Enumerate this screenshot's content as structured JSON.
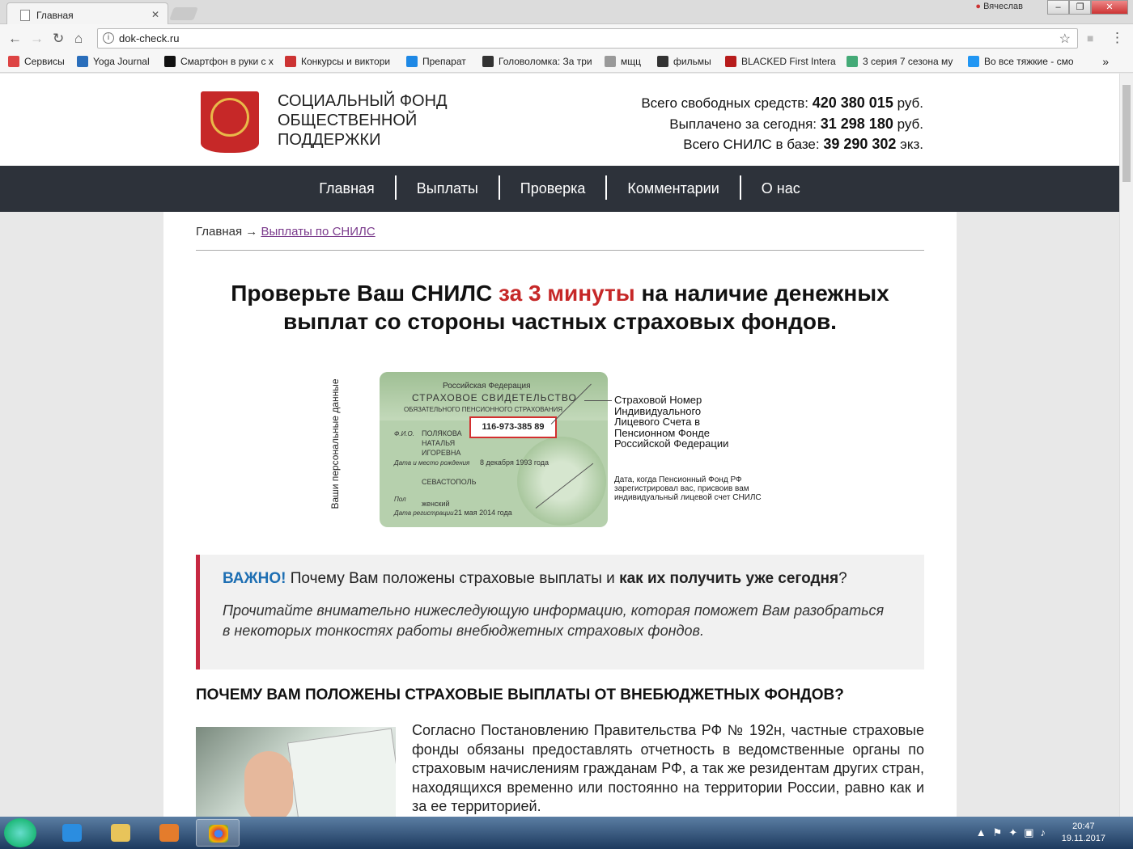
{
  "browser": {
    "tab_title": "Главная",
    "tab_close": "✕",
    "user": "Вячеслав",
    "url": "dok-check.ru",
    "bookmarks": [
      {
        "label": "Сервисы",
        "color": "#d44"
      },
      {
        "label": "Yoga Journal",
        "color": "#2a6ebb"
      },
      {
        "label": "Смартфон в руки с х",
        "color": "#111"
      },
      {
        "label": "Конкурсы и виктори",
        "color": "#c33"
      },
      {
        "label": "Препарат",
        "color": "#1e88e5"
      },
      {
        "label": "Головоломка: За три",
        "color": "#333"
      },
      {
        "label": "мщц",
        "color": "#999"
      },
      {
        "label": "фильмы",
        "color": "#333"
      },
      {
        "label": "BLACKED First Intera",
        "color": "#b71c1c"
      },
      {
        "label": "3 серия 7 сезона му",
        "color": "#4a7"
      },
      {
        "label": "Во все тяжкие - смо",
        "color": "#2196f3"
      }
    ]
  },
  "header": {
    "brand_line1": "СОЦИАЛЬНЫЙ ФОНД",
    "brand_line2": "ОБЩЕСТВЕННОЙ",
    "brand_line3": "ПОДДЕРЖКИ",
    "stat1_label": "Всего свободных средств:",
    "stat1_value": "420 380 015",
    "stat1_unit": "руб.",
    "stat2_label": "Выплачено за сегодня:",
    "stat2_value": "31 298 180",
    "stat2_unit": "руб.",
    "stat3_label": "Всего СНИЛС в базе:",
    "stat3_value": "39 290 302",
    "stat3_unit": "экз."
  },
  "menu": {
    "home": "Главная",
    "payments": "Выплаты",
    "check": "Проверка",
    "comments": "Комментарии",
    "about": "О нас"
  },
  "breadcrumb": {
    "home": "Главная",
    "arrow": "→",
    "current": "Выплаты по СНИЛС"
  },
  "headline": {
    "part1": "Проверьте Ваш СНИЛС ",
    "accent": "за 3 минуты",
    "part2": " на наличие денежных выплат со стороны частных страховых фондов."
  },
  "card": {
    "country": "Российская Федерация",
    "title": "СТРАХОВОЕ СВИДЕТЕЛЬСТВО",
    "subtitle": "ОБЯЗАТЕЛЬНОГО ПЕНСИОННОГО СТРАХОВАНИЯ",
    "number": "116-973-385 89",
    "fio_label": "Ф.И.О.",
    "fio1": "ПОЛЯКОВА",
    "fio2": "НАТАЛЬЯ",
    "fio3": "ИГОРЕВНА",
    "birth_label": "Дата и место рождения",
    "birth_date": "8 декабря 1993 года",
    "city": "СЕВАСТОПОЛЬ",
    "sex_label": "Пол",
    "sex": "женский",
    "reg_label": "Дата регистрации",
    "reg_date": "21 мая 2014 года",
    "side_label": "Ваши персональные данные",
    "callout1_l1": "Страховой Номер",
    "callout1_l2": "Индивидуального",
    "callout1_l3": "Лицевого Счета в",
    "callout1_l4": "Пенсионном Фонде",
    "callout1_l5": "Российской Федерации",
    "callout2_l1": "Дата, когда Пенсионный Фонд РФ",
    "callout2_l2": "зарегистрировал вас, присвоив вам",
    "callout2_l3": "индивидуальный лицевой счет СНИЛС"
  },
  "important": {
    "label": "ВАЖНО!",
    "text1": " Почему Вам положены страховые выплаты и ",
    "bold": "как их получить уже сегодня",
    "text2": "?",
    "italic": "Прочитайте внимательно нижеследующую информацию, которая поможет Вам разобраться в некоторых тонкостях работы внебюджетных страховых фондов."
  },
  "section": {
    "heading": "ПОЧЕМУ ВАМ ПОЛОЖЕНЫ СТРАХОВЫЕ ВЫПЛАТЫ ОТ ВНЕБЮДЖЕТНЫХ ФОНДОВ?",
    "paragraph": "Согласно Постановлению Правительства РФ № 192н, частные страховые фонды обязаны предоставлять отчетность в ведомственные органы по страховым начислениям гражданам РФ, а так же резидентам других стран, находящихся временно или постоянно на территории России, равно как и за ее территорией."
  },
  "taskbar": {
    "time": "20:47",
    "date": "19.11.2017"
  }
}
